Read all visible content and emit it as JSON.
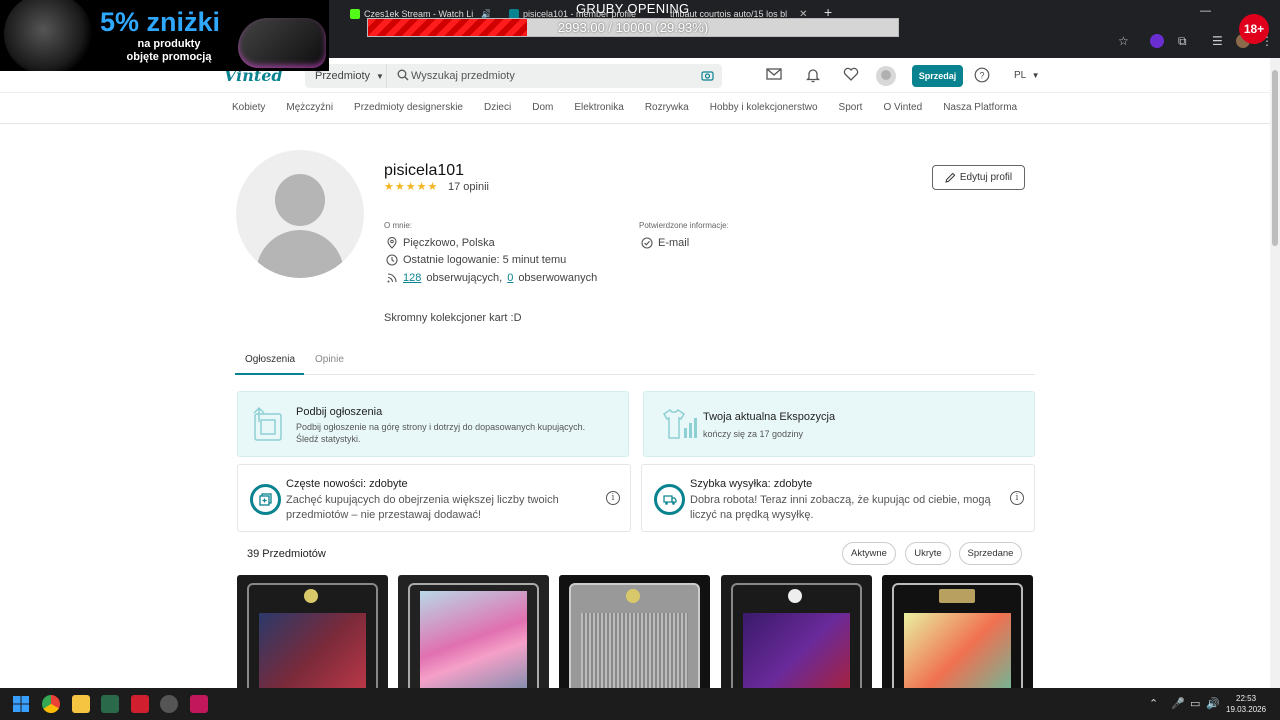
{
  "browser": {
    "tabs": [
      {
        "title": "Czes1ek Stream - Watch Li"
      },
      {
        "title": "pisicela101 - member profile"
      },
      {
        "title": "thibaut courtois auto/15 los bl"
      }
    ],
    "new_tab": "+"
  },
  "overlay": {
    "ad_headline": "5% zniżki",
    "ad_line1": "na produkty",
    "ad_line2": "objęte promocją",
    "stream_title": "GRUBY OPENING",
    "goal_text": "2993.00 / 10000 (29.93%)",
    "goal_fraction": 0.2993,
    "age_badge": "18+"
  },
  "header": {
    "logo": "Vinted",
    "category_select": "Przedmioty",
    "search_placeholder": "Wyszukaj przedmioty",
    "sell_label": "Sprzedaj",
    "lang": "PL"
  },
  "catnav": [
    "Kobiety",
    "Mężczyźni",
    "Przedmioty designerskie",
    "Dzieci",
    "Dom",
    "Elektronika",
    "Rozrywka",
    "Hobby i kolekcjonerstwo",
    "Sport",
    "O Vinted",
    "Nasza Platforma"
  ],
  "profile": {
    "username": "pisicela101",
    "stars": "★★★★★",
    "reviews": "17 opinii",
    "edit_label": "Edytuj profil",
    "about_label": "O mnie:",
    "location": "Pięczkowo, Polska",
    "last_login": "Ostatnie logowanie: 5 minut temu",
    "followers_count": "128",
    "followers_label": "obserwujących,",
    "following_count": "0",
    "following_label": "obserwowanych",
    "verified_label": "Potwierdzone informacje:",
    "verified_email": "E-mail",
    "bio": "Skromny kolekcjoner kart :D"
  },
  "tabs": {
    "listings": "Ogłoszenia",
    "reviews": "Opinie"
  },
  "promos": {
    "bump_title": "Podbij ogłoszenia",
    "bump_sub1": "Podbij ogłoszenie na górę strony i dotrzyj do dopasowanych kupujących.",
    "bump_sub2": "Śledź statystyki.",
    "exposure_title": "Twoja aktualna Ekspozycja",
    "exposure_sub": "kończy się za 17 godziny"
  },
  "badges": {
    "frequent_title": "Częste nowości: zdobyte",
    "frequent_sub1": "Zachęć kupujących do obejrzenia większej liczby twoich",
    "frequent_sub2": "przedmiotów – nie przestawaj dodawać!",
    "shipping_title": "Szybka wysyłka: zdobyte",
    "shipping_sub1": "Dobra robota! Teraz inni zobaczą, że kupując od ciebie, mogą",
    "shipping_sub2": "liczyć na prędką wysyłkę."
  },
  "listings": {
    "count": "39 Przedmiotów",
    "filters": [
      "Aktywne",
      "Ukryte",
      "Sprzedane"
    ]
  },
  "taskbar": {
    "time": "22:53",
    "date": "19.03.2026"
  },
  "colors": {
    "accent": "#09838f",
    "star": "#f3b51f",
    "promo_bg": "#e8f8f8"
  }
}
